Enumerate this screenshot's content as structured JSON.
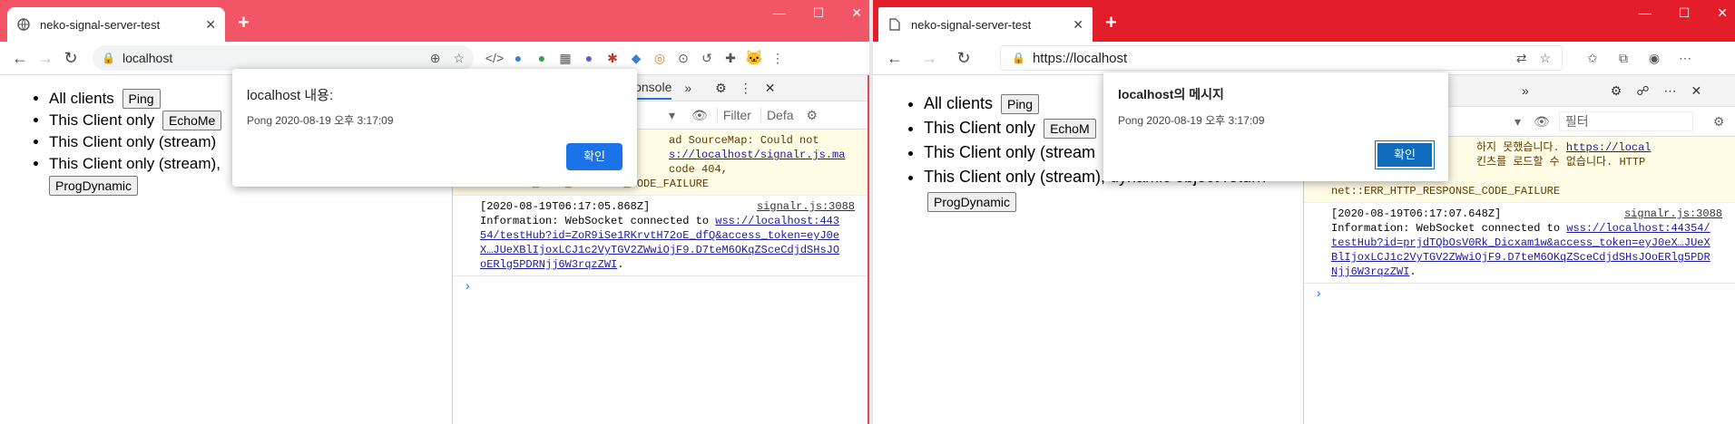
{
  "chrome": {
    "tab_title": "neko-signal-server-test",
    "url": "localhost",
    "page": {
      "items": [
        {
          "label": "All clients",
          "button": "Ping"
        },
        {
          "label": "This Client only",
          "button": "EchoMe"
        },
        {
          "label": "This Client only (stream)",
          "button": ""
        },
        {
          "label": "This Client only (stream),",
          "button": "ProgDynamic"
        }
      ]
    },
    "devtools": {
      "tab": "Console",
      "filter_placeholder": "Filter",
      "levels": "Defa",
      "warn_text": "DevTools failed to load SourceMap: Could not load content for https://localhost/signalr.js.map: HTTP error: status code 404, net::ERR_HTTP_RESPONSE_CODE_FAILURE",
      "warn_visible_1": "ad SourceMap: Could not",
      "warn_visible_2": "s://localhost/signalr.js.ma",
      "warn_visible_3": "code 404,",
      "warn_visible_4": "net::ERR_HTTP_RESPONSE_CODE_FAILURE",
      "info_time": "[2020-08-19T06:17:05.868Z]",
      "info_src": "signalr.js:3088",
      "info_text": "Information: WebSocket connected to",
      "info_link": "wss://localhost:44354/testHub?id=ZoR9iSe1RKrvtH72oE_dfQ&access_token=eyJ0eX…JUeXBlIjoxLCJ1c2VyTGV2ZWwiOjF9.D7teM6OKqZSceCdjdSHsJOoERlg5PDRNjj6W3rqzZWI",
      "info_end": "."
    },
    "dialog": {
      "title": "localhost 내용:",
      "message": "Pong 2020-08-19 오후 3:17:09",
      "ok": "확인"
    }
  },
  "edge": {
    "tab_title": "neko-signal-server-test",
    "url": "https://localhost",
    "page": {
      "items": [
        {
          "label": "All clients",
          "button": "Ping"
        },
        {
          "label": "This Client only",
          "button": "EchoM"
        },
        {
          "label": "This Client only (stream",
          "button": ""
        },
        {
          "label": "This Client only (stream), dynamic object return",
          "button": "ProgDynamic"
        }
      ]
    },
    "devtools": {
      "filter_placeholder": "필터",
      "warn_visible_1": "하지 못했습니다.",
      "warn_link": "https://local",
      "warn_visible_2": "킨츠를 로드할 수 없습니다. HTTP",
      "warn_visible_3": "오류: 상태 코드 404,",
      "warn_visible_4": "net::ERR_HTTP_RESPONSE_CODE_FAILURE",
      "info_time": "[2020-08-19T06:17:07.648Z]",
      "info_src": "signalr.js:3088",
      "info_text": "Information: WebSocket connected to",
      "info_link": "wss://localhost:44354/testHub?id=prjdTQbOsV0Rk_Dicxam1w&access_token=eyJ0eX…JUeXBlIjoxLCJ1c2VyTGV2ZWwiOjF9.D7teM6OKqZSceCdjdSHsJOoERlg5PDRNjj6W3rqzZWI",
      "info_end": "."
    },
    "dialog": {
      "title": "localhost의 메시지",
      "message": "Pong 2020-08-19 오후 3:17:09",
      "ok": "확인"
    }
  }
}
